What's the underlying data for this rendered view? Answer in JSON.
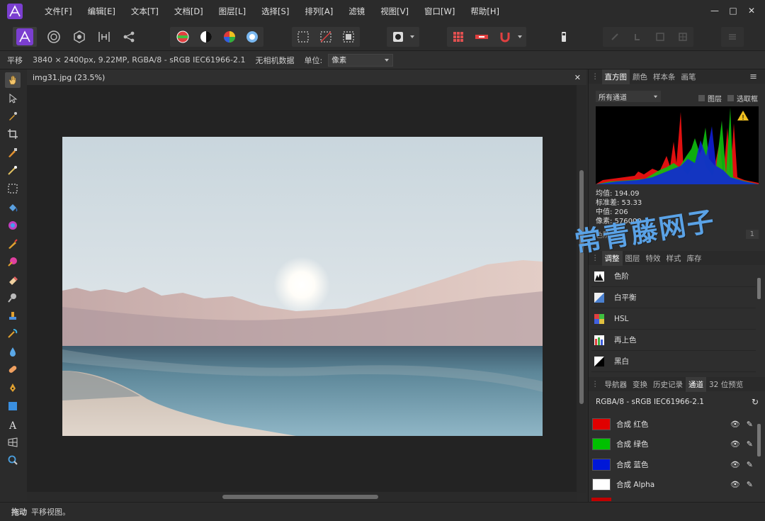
{
  "menubar": {
    "items": [
      "文件[F]",
      "编辑[E]",
      "文本[T]",
      "文档[D]",
      "图层[L]",
      "选择[S]",
      "排列[A]",
      "滤镜",
      "视图[V]",
      "窗口[W]",
      "帮助[H]"
    ],
    "minimize": "—",
    "maximize": "□",
    "close": "✕"
  },
  "contextbar": {
    "tool_name": "平移",
    "doc_info": "3840 × 2400px, 9.22MP, RGBA/8 - sRGB IEC61966-2.1",
    "camera": "无相机数据",
    "unit_label": "单位:",
    "unit_value": "像素"
  },
  "document": {
    "tab_title": "img31.jpg (23.5%)",
    "close": "✕"
  },
  "status": {
    "label": "拖动",
    "text": "平移视图。"
  },
  "histogram": {
    "tabs": [
      "直方图",
      "颜色",
      "样本条",
      "画笔"
    ],
    "channel_select": "所有通道",
    "layer_check": "图层",
    "selection_check": "选取框",
    "warning_icon": "warning-icon",
    "stats": {
      "mean": "均值: 194.09",
      "stddev": "标准差: 53.33",
      "median": "中值: 206",
      "pixels": "像素: 576000"
    },
    "level_label": "色阶",
    "level_value": "1"
  },
  "adjustments": {
    "tabs": [
      "调整",
      "图层",
      "特效",
      "样式",
      "库存"
    ],
    "items": [
      "色阶",
      "白平衡",
      "HSL",
      "再上色",
      "黑白"
    ]
  },
  "channels": {
    "tabs": [
      "导航器",
      "变换",
      "历史记录",
      "通道",
      "32 位预览"
    ],
    "profile": "RGBA/8 - sRGB IEC61966-2.1",
    "items": [
      {
        "label": "合成 红色",
        "color": "#e00000"
      },
      {
        "label": "合成 绿色",
        "color": "#00c000"
      },
      {
        "label": "合成 蓝色",
        "color": "#0018d8"
      },
      {
        "label": "合成 Alpha",
        "color": "#ffffff"
      }
    ]
  },
  "watermark": "常青藤网子",
  "colors": {
    "accent": "#7b3fd0",
    "panel_bg": "#2e2e2e",
    "canvas_bg": "#232323"
  }
}
